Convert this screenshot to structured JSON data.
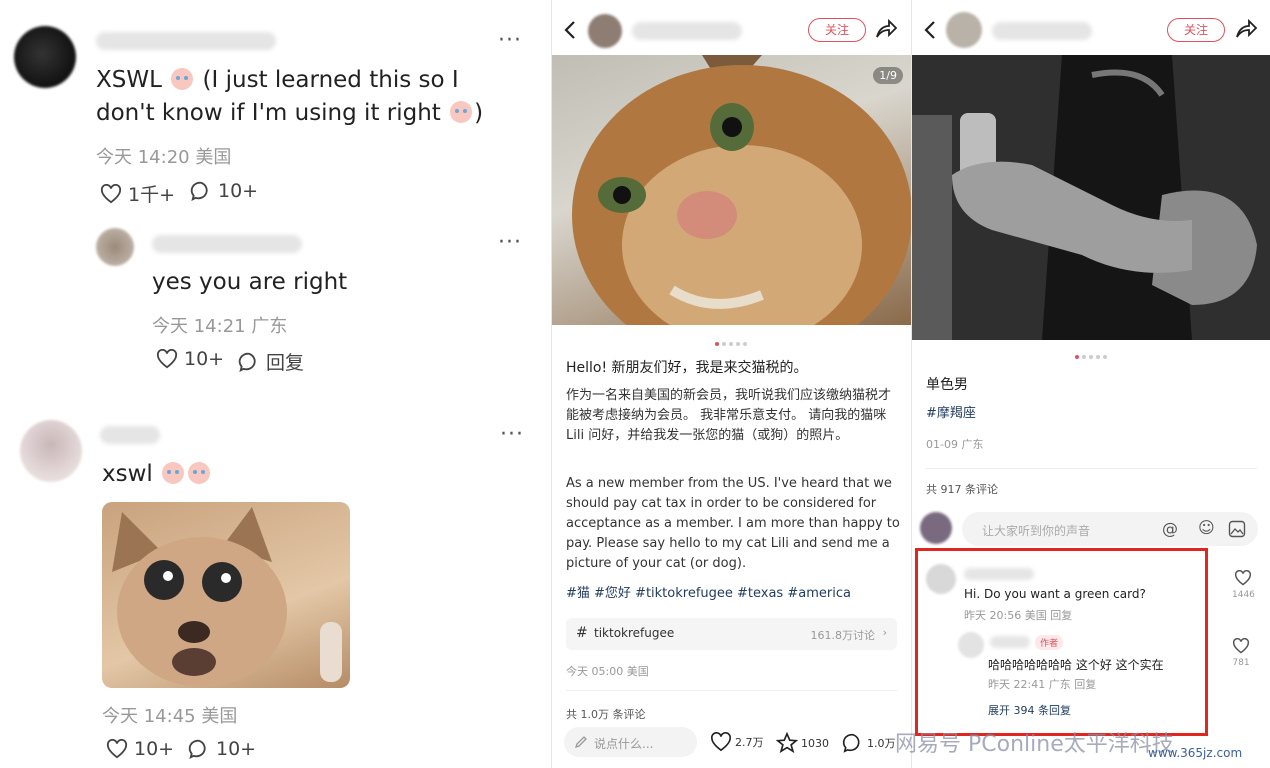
{
  "panel1": {
    "comment1": {
      "text_a": "XSWL",
      "text_b": "(I just learned this so I don't know if I'm using it right",
      "text_c": ")",
      "meta": "今天 14:20 美国",
      "likes": "1千+",
      "replies": "10+"
    },
    "reply1": {
      "text": "yes you are right",
      "meta": "今天 14:21 广东",
      "likes": "10+",
      "reply_label": "回复"
    },
    "comment2": {
      "text": "xswl",
      "meta": "今天 14:45 美国",
      "likes": "10+",
      "replies": "10+"
    }
  },
  "panel2": {
    "follow_label": "关注",
    "image_counter": "1/9",
    "title": "Hello! 新朋友们好，我是来交猫税的。",
    "body_cn": "作为一名来自美国的新会员，我听说我们应该缴纳猫税才能被考虑接纳为会员。 我非常乐意支付。 请向我的猫咪 Lili 问好，并给我发一张您的猫（或狗）的照片。",
    "body_en": "As a new member from the US. I've heard that we should pay cat tax in order to be considered for acceptance as a member. I am more than happy to pay. Please say hello to my cat Lili and send me a picture of your cat (or dog).",
    "tags": "#猫 #您好 #tiktokrefugee #texas #america",
    "topic_name": "tiktokrefugee",
    "topic_count": "161.8万讨论",
    "date": "今天 05:00 美国",
    "comment_count": "共 1.0万 条评论",
    "input_placeholder": "说点什么...",
    "likes": "2.7万",
    "stars": "1030",
    "comments": "1.0万"
  },
  "panel3": {
    "follow_label": "关注",
    "title": "单色男",
    "tag": "#摩羯座",
    "date": "01-09 广东",
    "comment_count": "共 917 条评论",
    "input_placeholder": "让大家听到你的声音",
    "c1_text": "Hi. Do you want a green card?",
    "c1_meta": "昨天 20:56 美国 回复",
    "c1_likes": "1446",
    "author_badge": "作者",
    "c2_text": "哈哈哈哈哈哈哈 这个好 这个实在",
    "c2_meta": "昨天 22:41 广东 回复",
    "c2_likes": "781",
    "expand": "展开 394 条回复"
  },
  "watermark": {
    "text": "网易号 PConline太平洋科技",
    "url": "www.365jz.com"
  },
  "colors": {
    "accent": "#e0515e",
    "highlight_box": "#e0261f",
    "hashtag": "#1f3b5e"
  }
}
